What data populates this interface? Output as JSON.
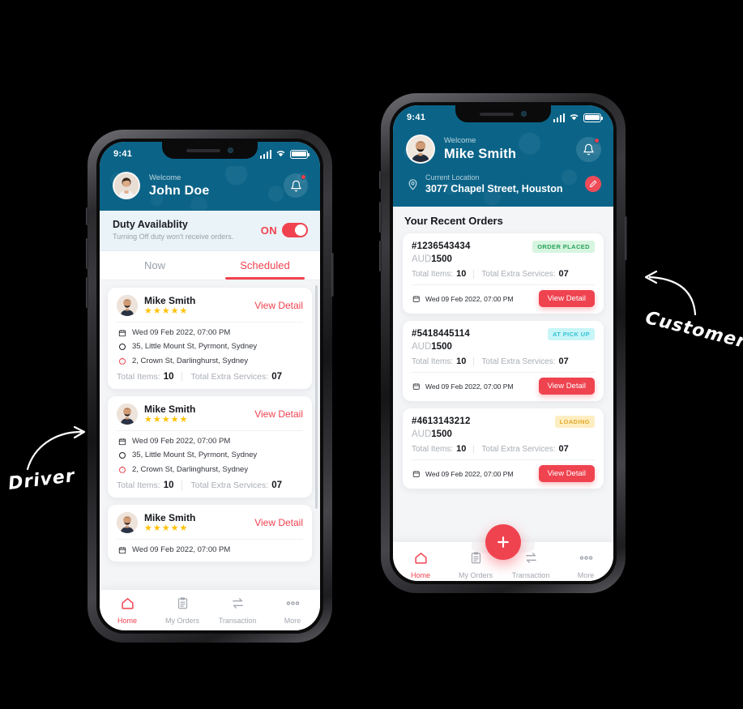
{
  "annotations": {
    "driver_label": "Driver",
    "customer_label": "Customer"
  },
  "colors": {
    "header_blue": "#0b6488",
    "accent_red": "#f0424f",
    "button_red": "#ef4350",
    "star_gold": "#ffc107",
    "duty_bg": "#eaf3f8",
    "badge_green_bg": "#d7f5e0",
    "badge_green_text": "#2aa35a",
    "badge_cyan_bg": "#c8f5f7",
    "badge_cyan_text": "#32c4d6",
    "badge_yellow_bg": "#fdeec2",
    "badge_yellow_text": "#e3a92a"
  },
  "driver_phone": {
    "status_bar": {
      "time": "9:41",
      "signal_icon": "cellular-bars-icon",
      "wifi_icon": "wifi-icon",
      "battery_icon": "battery-full-icon"
    },
    "header": {
      "avatar_icon": "user-avatar",
      "welcome_label": "Welcome",
      "user_name": "John Doe",
      "notification_icon": "bell-icon"
    },
    "duty": {
      "title": "Duty Availablity",
      "subtitle": "Turning Off duty won't receive orders.",
      "toggle_state_label": "ON"
    },
    "tabs": [
      {
        "label": "Now",
        "active": false
      },
      {
        "label": "Scheduled",
        "active": true
      }
    ],
    "orders": [
      {
        "name": "Mike Smith",
        "stars": "★★★★★",
        "action": "View Detail",
        "date": "Wed 09 Feb 2022, 07:00 PM",
        "pickup": "35, Little Mount St, Pyrmont, Sydney",
        "dropoff": "2, Crown St, Darlinghurst, Sydney",
        "total_items_label": "Total Items:",
        "total_items": "10",
        "extra_services_label": "Total Extra Services:",
        "extra_services": "07"
      },
      {
        "name": "Mike Smith",
        "stars": "★★★★★",
        "action": "View Detail",
        "date": "Wed 09 Feb 2022, 07:00 PM",
        "pickup": "35, Little Mount St, Pyrmont, Sydney",
        "dropoff": "2, Crown St, Darlinghurst, Sydney",
        "total_items_label": "Total Items:",
        "total_items": "10",
        "extra_services_label": "Total Extra Services:",
        "extra_services": "07"
      },
      {
        "name": "Mike Smith",
        "stars": "★★★★★",
        "action": "View Detail",
        "date": "Wed 09 Feb 2022, 07:00 PM",
        "pickup": "",
        "dropoff": "",
        "total_items_label": "",
        "total_items": "",
        "extra_services_label": "",
        "extra_services": ""
      }
    ],
    "bottom_nav": [
      {
        "label": "Home",
        "icon": "home-icon",
        "active": true
      },
      {
        "label": "My Orders",
        "icon": "clipboard-icon",
        "active": false
      },
      {
        "label": "Transaction",
        "icon": "transfer-arrows-icon",
        "active": false
      },
      {
        "label": "More",
        "icon": "ellipsis-icon",
        "active": false
      }
    ]
  },
  "customer_phone": {
    "status_bar": {
      "time": "9:41",
      "signal_icon": "cellular-bars-icon",
      "wifi_icon": "wifi-icon",
      "battery_icon": "battery-full-icon"
    },
    "header": {
      "avatar_icon": "user-avatar",
      "welcome_label": "Welcome",
      "user_name": "Mike Smith",
      "notification_icon": "bell-icon",
      "location_label": "Current Location",
      "location_value": "3077 Chapel Street, Houston",
      "location_pin_icon": "map-pin-icon",
      "edit_icon": "pencil-icon"
    },
    "section_title": "Your Recent Orders",
    "orders": [
      {
        "order_id": "#1236543434",
        "status": "ORDER PLACED",
        "status_kind": "green",
        "currency": "AUD",
        "amount": "1500",
        "total_items_label": "Total Items:",
        "total_items": "10",
        "extra_services_label": "Total Extra Services:",
        "extra_services": "07",
        "date": "Wed 09 Feb 2022, 07:00 PM",
        "action": "View Detail"
      },
      {
        "order_id": "#5418445114",
        "status": "AT PICK UP",
        "status_kind": "cyan",
        "currency": "AUD",
        "amount": "1500",
        "total_items_label": "Total Items:",
        "total_items": "10",
        "extra_services_label": "Total Extra Services:",
        "extra_services": "07",
        "date": "Wed 09 Feb 2022, 07:00 PM",
        "action": "View Detail"
      },
      {
        "order_id": "#4613143212",
        "status": "LOADING",
        "status_kind": "yellow",
        "currency": "AUD",
        "amount": "1500",
        "total_items_label": "Total Items:",
        "total_items": "10",
        "extra_services_label": "Total Extra Services:",
        "extra_services": "07",
        "date": "Wed 09 Feb 2022, 07:00 PM",
        "action": "View Detail"
      }
    ],
    "fab_label": "+",
    "bottom_nav": [
      {
        "label": "Home",
        "icon": "home-icon",
        "active": true
      },
      {
        "label": "My Orders",
        "icon": "clipboard-icon",
        "active": false
      },
      {
        "label": "Transaction",
        "icon": "transfer-arrows-icon",
        "active": false
      },
      {
        "label": "More",
        "icon": "ellipsis-icon",
        "active": false
      }
    ]
  }
}
